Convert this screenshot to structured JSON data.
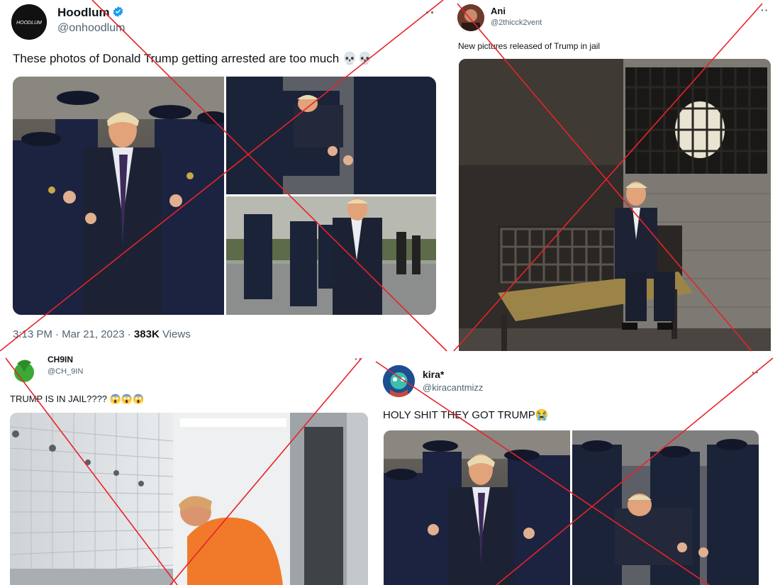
{
  "colors": {
    "cross": "#e8222a",
    "handle": "#536471",
    "verified": "#1d9bf0",
    "jail_orange": "#f07a2a"
  },
  "tweets": [
    {
      "name": "Hoodlum",
      "verified": true,
      "handle": "@onhoodlum",
      "avatar_text": "HOODLUM",
      "text": "These photos of Donald Trump getting arrested are too much 💀💀",
      "time": "3:13 PM · Mar 21, 2023 · ",
      "views_count": "383K",
      "views_label": " Views",
      "more": "··"
    },
    {
      "name": "Ani",
      "handle": "@2thicck2vent",
      "text": "New pictures released of Trump in jail",
      "more": "··"
    },
    {
      "name": "CH9IN",
      "handle": "@CH_9IN",
      "text": "TRUMP IS IN JAIL???? 😱😱😱",
      "more": "··"
    },
    {
      "name": "kira*",
      "handle": "@kiracantmizz",
      "text": "HOLY SHIT THEY GOT TRUMP😭",
      "more": "··"
    }
  ]
}
